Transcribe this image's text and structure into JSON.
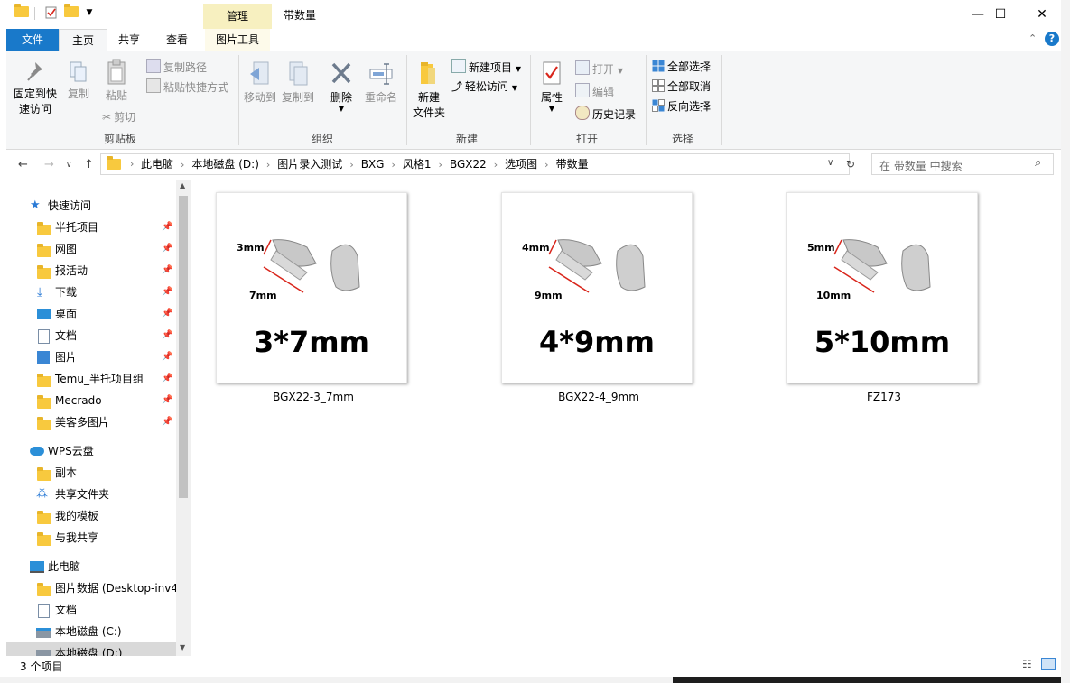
{
  "window": {
    "title": "带数量",
    "context_tab_group": "管理",
    "minimize": "—",
    "maximize": "☐",
    "close": "✕"
  },
  "ribbon_tabs": [
    "文件",
    "主页",
    "共享",
    "查看",
    "图片工具"
  ],
  "ribbon": {
    "clipboard": {
      "pin_quick_access": "固定到快\n速访问",
      "pin_line1": "固定到快",
      "pin_line2": "速访问",
      "copy": "复制",
      "paste": "粘贴",
      "copy_path": "复制路径",
      "paste_shortcut": "粘贴快捷方式",
      "cut": "剪切",
      "label": "剪贴板"
    },
    "organize": {
      "move_to": "移动到",
      "copy_to": "复制到",
      "delete": "删除",
      "rename": "重命名",
      "label": "组织"
    },
    "new": {
      "new_folder_line1": "新建",
      "new_folder_line2": "文件夹",
      "new_item": "新建项目",
      "easy_access": "轻松访问",
      "label": "新建"
    },
    "open": {
      "properties": "属性",
      "open": "打开",
      "edit": "编辑",
      "history": "历史记录",
      "label": "打开"
    },
    "select": {
      "select_all": "全部选择",
      "select_none": "全部取消",
      "invert": "反向选择",
      "label": "选择"
    }
  },
  "address": {
    "breadcrumbs": [
      "此电脑",
      "本地磁盘 (D:)",
      "图片录入测试",
      "BXG",
      "风格1",
      "BGX22",
      "选项图",
      "带数量"
    ],
    "search_placeholder": "在 带数量 中搜索"
  },
  "nav_pane": {
    "quick_access": "快速访问",
    "quick_items": [
      "半托项目",
      "网图",
      "报活动",
      "下载",
      "桌面",
      "文档",
      "图片",
      "Temu_半托项目组",
      "Mecrado",
      "美客多图片"
    ],
    "wps": "WPS云盘",
    "wps_items": [
      "副本",
      "共享文件夹",
      "我的模板",
      "与我共享"
    ],
    "this_pc": "此电脑",
    "pc_items": [
      "图片数据 (Desktop-inv4",
      "文档",
      "本地磁盘 (C:)",
      "本地磁盘 (D:)"
    ]
  },
  "files": [
    {
      "name": "BGX22-3_7mm",
      "size_text": "3*7mm",
      "dim1": "3mm",
      "dim2": "7mm"
    },
    {
      "name": "BGX22-4_9mm",
      "size_text": "4*9mm",
      "dim1": "4mm",
      "dim2": "9mm"
    },
    {
      "name": "FZ173",
      "size_text": "5*10mm",
      "dim1": "5mm",
      "dim2": "10mm"
    }
  ],
  "status": {
    "item_count": "3 个项目"
  },
  "colors": {
    "accent": "#1979ca",
    "context_tab": "#f7f0c0",
    "dim_red": "#d9261c"
  }
}
